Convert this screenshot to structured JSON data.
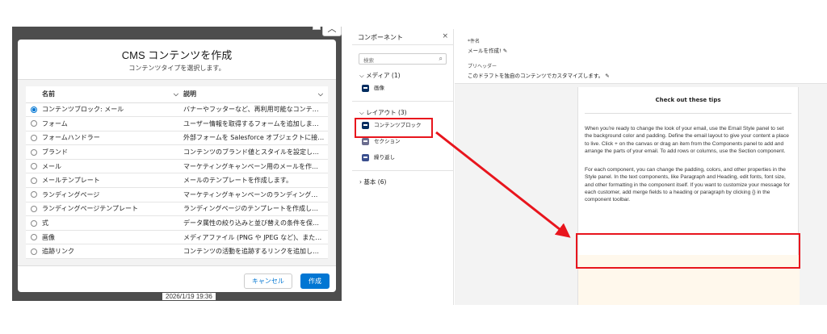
{
  "left_shot": {
    "modal": {
      "title": "CMS コンテンツを作成",
      "subtitle": "コンテンツタイプを選択します。",
      "columns": [
        "名前",
        "説明"
      ],
      "rows": [
        {
          "name": "コンテンツブロック: メール",
          "desc": "バナーやフッターなど、再利用可能なコンテ…",
          "selected": true
        },
        {
          "name": "フォーム",
          "desc": "ユーザー情報を取得するフォームを追加しま…",
          "selected": false
        },
        {
          "name": "フォームハンドラー",
          "desc": "外部フォームを Salesforce オブジェクトに接…",
          "selected": false
        },
        {
          "name": "ブランド",
          "desc": "コンテンツのブランド値とスタイルを設定し…",
          "selected": false
        },
        {
          "name": "メール",
          "desc": "マーケティングキャンペーン用のメールを作…",
          "selected": false
        },
        {
          "name": "メールテンプレート",
          "desc": "メールのテンプレートを作成します。",
          "selected": false
        },
        {
          "name": "ランディングページ",
          "desc": "マーケティングキャンペーンのランディング…",
          "selected": false
        },
        {
          "name": "ランディングページテンプレート",
          "desc": "ランディングページのテンプレートを作成し…",
          "selected": false
        },
        {
          "name": "式",
          "desc": "データ属性の絞り込みと並び替えの条件を保…",
          "selected": false
        },
        {
          "name": "画像",
          "desc": "メディアファイル (PNG や JPEG など)、また…",
          "selected": false
        },
        {
          "name": "追跡リンク",
          "desc": "コンテンツの活動を追跡するリンクを追加し…",
          "selected": false
        }
      ],
      "cancel_label": "キャンセル",
      "create_label": "作成"
    },
    "timestamp": "2026/1/19 19:36"
  },
  "right_shot": {
    "panel": {
      "title": "コンポーネント",
      "search_placeholder": "検索",
      "sections": {
        "media": "メディア (1)",
        "layout": "レイアウト (3)",
        "basic": "基本 (6)"
      },
      "items": {
        "image": "画像",
        "content_block": "コンテンツブロック",
        "section": "セクション",
        "repeat": "繰り返し"
      }
    },
    "props": {
      "subject_label": "*件名",
      "subject_value": "メールを作成!",
      "preheader_label": "プリヘッダー",
      "preheader_value": "このドラフトを独自のコンテンツでカスタマイズします。"
    },
    "email": {
      "heading": "Check out these tips",
      "para1": "When you're ready to change the look of your email, use the Email Style panel to set the background color and padding. Define the email layout to give your content a place to live. Click + on the canvas or drag an item from the Components panel to add and arrange the parts of your email. To add rows or columns, use the Section component.",
      "para2": "For each component, you can change the padding, colors, and other properties in the Style panel. In the text components, like Paragraph and Heading, edit fonts, font size, and other formatting in the component itself. If you want to customize your message for each customer, add merge fields to a heading or paragraph by clicking {} in the component toolbar."
    }
  },
  "colors": {
    "brand": "#0176d3",
    "highlight": "#e8151d"
  }
}
